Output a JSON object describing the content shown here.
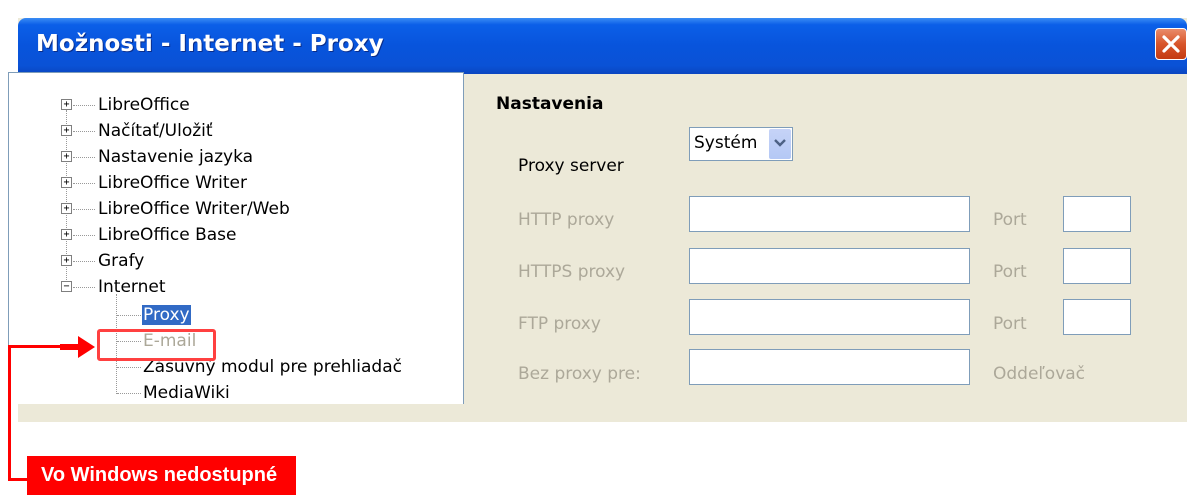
{
  "window": {
    "title": "Možnosti - Internet - Proxy"
  },
  "tree": {
    "items": [
      {
        "label": "LibreOffice",
        "expander": "+"
      },
      {
        "label": "Načítať/Uložiť",
        "expander": "+"
      },
      {
        "label": "Nastavenie jazyka",
        "expander": "+"
      },
      {
        "label": "LibreOffice Writer",
        "expander": "+"
      },
      {
        "label": "LibreOffice Writer/Web",
        "expander": "+"
      },
      {
        "label": "LibreOffice Base",
        "expander": "+"
      },
      {
        "label": "Grafy",
        "expander": "+"
      },
      {
        "label": "Internet",
        "expander": "−"
      }
    ],
    "children": [
      {
        "label": "Proxy",
        "state": "selected"
      },
      {
        "label": "E-mail",
        "state": "disabled"
      },
      {
        "label": "Zásuvný modul pre prehliadač",
        "state": "normal"
      },
      {
        "label": "MediaWiki",
        "state": "normal"
      }
    ]
  },
  "settings": {
    "heading": "Nastavenia",
    "proxy_server_label": "Proxy server",
    "proxy_server_value": "Systém",
    "http_label": "HTTP proxy",
    "https_label": "HTTPS proxy",
    "ftp_label": "FTP proxy",
    "no_proxy_label": "Bez proxy pre:",
    "port_label": "Port",
    "separator_label": "Oddeľovač",
    "http_value": "",
    "https_value": "",
    "ftp_value": "",
    "no_proxy_value": "",
    "http_port": "",
    "https_port": "",
    "ftp_port": ""
  },
  "callout": {
    "text": "Vo Windows nedostupné",
    "color": "#ff0000"
  },
  "colors": {
    "titlebar": "#0854dc",
    "selection": "#316ac5",
    "dialog_bg": "#ece9d8",
    "disabled_text": "#aca899"
  }
}
